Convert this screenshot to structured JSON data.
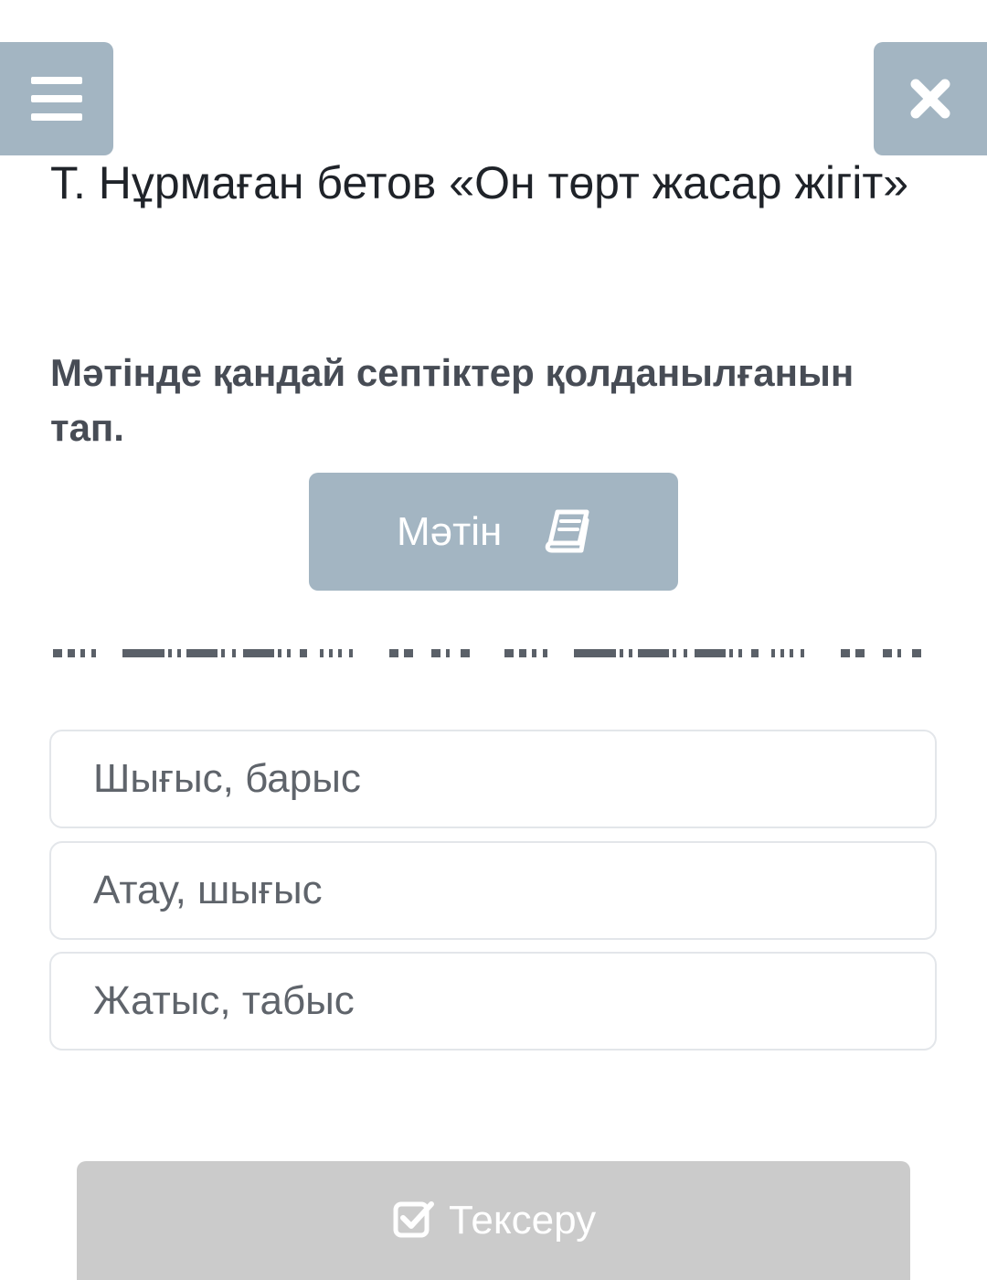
{
  "header": {
    "menu_icon": "hamburger-menu-icon",
    "close_icon": "close-x-icon"
  },
  "title": "Т. Нұрмаған бетов «Он төрт жасар жігіт»",
  "question": "Мәтінде қандай септіктер қолданылғанын тап.",
  "text_button": {
    "label": "Мәтін",
    "icon": "book-icon"
  },
  "options": [
    {
      "label": "Шығыс, барыс"
    },
    {
      "label": "Атау, шығыс"
    },
    {
      "label": "Жатыс, табыс"
    }
  ],
  "check_button": {
    "label": "Тексеру",
    "icon": "checkbox-icon"
  },
  "colors": {
    "accent": "#a3b5c2",
    "disabled_button": "#cbcbcb",
    "title_text": "#1f2329",
    "question_text": "#474c55",
    "option_text": "#5f646b",
    "option_border": "#e3e6ea"
  }
}
